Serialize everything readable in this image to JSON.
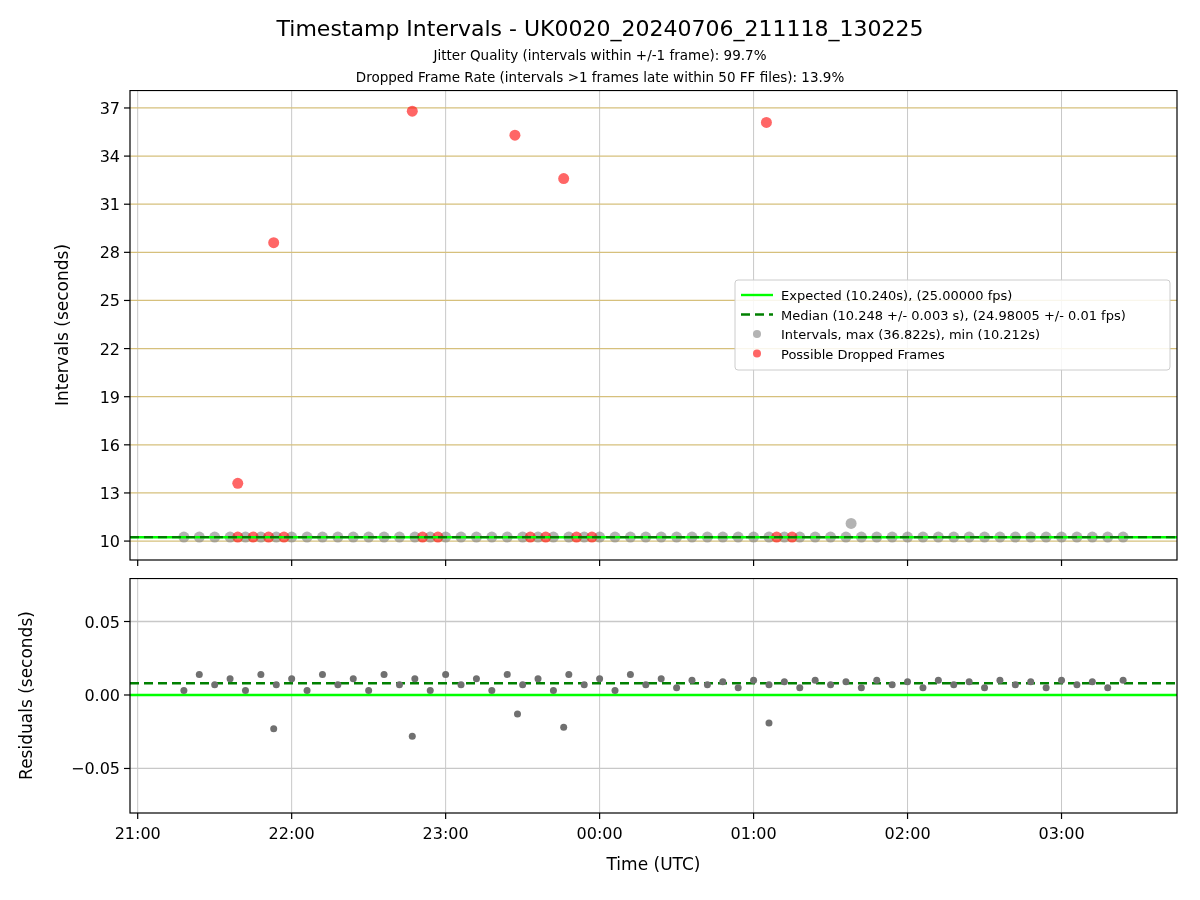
{
  "title": "Timestamp Intervals - UK0020_20240706_211118_130225",
  "subtitles": [
    "Jitter Quality (intervals within +/-1 frame): 99.7%",
    "Dropped Frame Rate (intervals >1 frames late within 50 FF files): 13.9%"
  ],
  "plots": [
    {
      "chart_data": {
        "type": "scatter",
        "grid": true,
        "legend": "center right",
        "ylabel": "Intervals (seconds)",
        "xlim": [
          "2024-07-06T20:57:00",
          "2024-07-07T03:45:00"
        ],
        "ylim": [
          8.82,
          38.12
        ],
        "yticks": [
          10,
          13,
          16,
          19,
          22,
          25,
          28,
          31,
          34,
          37
        ],
        "series": [
          {
            "name": "Expected (10.240s), (25.00000 fps)",
            "type": "line",
            "color": "#00ff00",
            "x": [
              "2024-07-06T20:57:00",
              "2024-07-07T03:45:00"
            ],
            "values": [
              10.24,
              10.24
            ]
          },
          {
            "name": "Median (10.248 +/- 0.003 s), (24.98005 +/- 0.01 fps)",
            "type": "line",
            "line_style": "dashed",
            "color": "#008000",
            "x": [
              "2024-07-06T20:57:00",
              "2024-07-07T03:45:00"
            ],
            "values": [
              10.25,
              10.25
            ]
          },
          {
            "name": "Intervals, max (36.822s), min (10.212s)",
            "type": "scatter",
            "color": "#808080",
            "x": [
              "2024-07-06T21:18:00",
              "2024-07-06T21:24:00",
              "2024-07-06T21:30:00",
              "2024-07-06T21:36:00",
              "2024-07-06T21:42:00",
              "2024-07-06T21:48:00",
              "2024-07-06T21:54:00",
              "2024-07-06T22:00:00",
              "2024-07-06T22:06:00",
              "2024-07-06T22:12:00",
              "2024-07-06T22:18:00",
              "2024-07-06T22:24:00",
              "2024-07-06T22:30:00",
              "2024-07-06T22:36:00",
              "2024-07-06T22:42:00",
              "2024-07-06T22:48:00",
              "2024-07-06T22:54:00",
              "2024-07-06T23:00:00",
              "2024-07-06T23:06:00",
              "2024-07-06T23:12:00",
              "2024-07-06T23:18:00",
              "2024-07-06T23:24:00",
              "2024-07-06T23:30:00",
              "2024-07-06T23:36:00",
              "2024-07-06T23:42:00",
              "2024-07-06T23:48:00",
              "2024-07-06T23:54:00",
              "2024-07-07T00:00:00",
              "2024-07-07T00:06:00",
              "2024-07-07T00:12:00",
              "2024-07-07T00:18:00",
              "2024-07-07T00:24:00",
              "2024-07-07T00:30:00",
              "2024-07-07T00:36:00",
              "2024-07-07T00:42:00",
              "2024-07-07T00:48:00",
              "2024-07-07T00:54:00",
              "2024-07-07T01:00:00",
              "2024-07-07T01:06:00",
              "2024-07-07T01:12:00",
              "2024-07-07T01:18:00",
              "2024-07-07T01:24:00",
              "2024-07-07T01:30:00",
              "2024-07-07T01:36:00",
              "2024-07-07T01:42:00",
              "2024-07-07T01:48:00",
              "2024-07-07T01:54:00",
              "2024-07-07T02:00:00",
              "2024-07-07T02:06:00",
              "2024-07-07T02:12:00",
              "2024-07-07T02:18:00",
              "2024-07-07T02:24:00",
              "2024-07-07T02:30:00",
              "2024-07-07T02:36:00",
              "2024-07-07T02:42:00",
              "2024-07-07T02:48:00",
              "2024-07-07T02:54:00",
              "2024-07-07T03:00:00",
              "2024-07-07T03:06:00",
              "2024-07-07T03:12:00",
              "2024-07-07T03:18:00",
              "2024-07-07T03:24:00",
              "2024-07-07T01:38:00"
            ],
            "values": [
              10.25,
              10.25,
              10.25,
              10.25,
              10.25,
              10.25,
              10.25,
              10.25,
              10.25,
              10.25,
              10.25,
              10.25,
              10.25,
              10.25,
              10.25,
              10.25,
              10.25,
              10.25,
              10.25,
              10.25,
              10.25,
              10.25,
              10.25,
              10.25,
              10.25,
              10.25,
              10.25,
              10.25,
              10.25,
              10.25,
              10.25,
              10.25,
              10.25,
              10.25,
              10.25,
              10.25,
              10.25,
              10.25,
              10.25,
              10.25,
              10.25,
              10.25,
              10.25,
              10.25,
              10.25,
              10.25,
              10.25,
              10.25,
              10.25,
              10.25,
              10.25,
              10.25,
              10.25,
              10.25,
              10.25,
              10.25,
              10.25,
              10.25,
              10.25,
              10.25,
              10.25,
              10.25,
              11.1
            ]
          },
          {
            "name": "Possible Dropped Frames",
            "type": "scatter",
            "color": "#ff0000",
            "x": [
              "2024-07-06T21:39:00",
              "2024-07-06T21:45:00",
              "2024-07-06T21:51:00",
              "2024-07-06T21:57:00",
              "2024-07-06T22:51:00",
              "2024-07-06T22:57:00",
              "2024-07-06T23:33:00",
              "2024-07-06T23:39:00",
              "2024-07-06T23:51:00",
              "2024-07-06T23:57:00",
              "2024-07-07T01:09:00",
              "2024-07-07T01:15:00",
              "2024-07-06T21:39:00",
              "2024-07-06T21:53:00",
              "2024-07-06T22:47:00",
              "2024-07-06T23:27:00",
              "2024-07-06T23:46:00",
              "2024-07-07T01:05:00"
            ],
            "values": [
              10.25,
              10.25,
              10.25,
              10.25,
              10.25,
              10.25,
              10.25,
              10.25,
              10.25,
              10.25,
              10.25,
              10.25,
              13.6,
              28.6,
              36.8,
              35.3,
              32.6,
              36.1
            ]
          }
        ]
      }
    },
    {
      "chart_data": {
        "type": "scatter",
        "grid": true,
        "xlabel": "Time (UTC)",
        "ylabel": "Residuals (seconds)",
        "xlim": [
          "2024-07-06T20:57:00",
          "2024-07-07T03:45:00"
        ],
        "ylim": [
          -0.0803,
          0.0796
        ],
        "xticks": [
          {
            "value": "2024-07-06T21:00:00",
            "label": "21:00"
          },
          {
            "value": "2024-07-06T22:00:00",
            "label": "22:00"
          },
          {
            "value": "2024-07-06T23:00:00",
            "label": "23:00"
          },
          {
            "value": "2024-07-07T00:00:00",
            "label": "00:00"
          },
          {
            "value": "2024-07-07T01:00:00",
            "label": "01:00"
          },
          {
            "value": "2024-07-07T02:00:00",
            "label": "02:00"
          },
          {
            "value": "2024-07-07T03:00:00",
            "label": "03:00"
          }
        ],
        "yticks": [
          {
            "value": -0.05,
            "label": "−0.05"
          },
          {
            "value": 0,
            "label": "0.00"
          },
          {
            "value": 0.05,
            "label": "0.05"
          }
        ],
        "series": [
          {
            "type": "line",
            "color": "#00ff00",
            "x": [
              "2024-07-06T20:57:00",
              "2024-07-07T03:45:00"
            ],
            "values": [
              0,
              0
            ]
          },
          {
            "type": "line",
            "line_style": "dashed",
            "color": "#008000",
            "x": [
              "2024-07-06T20:57:00",
              "2024-07-07T03:45:00"
            ],
            "values": [
              0.008,
              0.008
            ]
          },
          {
            "type": "scatter",
            "color": "#707070",
            "x": [
              "2024-07-06T21:18:00",
              "2024-07-06T21:24:00",
              "2024-07-06T21:30:00",
              "2024-07-06T21:36:00",
              "2024-07-06T21:42:00",
              "2024-07-06T21:48:00",
              "2024-07-06T21:54:00",
              "2024-07-06T22:00:00",
              "2024-07-06T22:06:00",
              "2024-07-06T22:12:00",
              "2024-07-06T22:18:00",
              "2024-07-06T22:24:00",
              "2024-07-06T22:30:00",
              "2024-07-06T22:36:00",
              "2024-07-06T22:42:00",
              "2024-07-06T22:48:00",
              "2024-07-06T22:54:00",
              "2024-07-06T23:00:00",
              "2024-07-06T23:06:00",
              "2024-07-06T23:12:00",
              "2024-07-06T23:18:00",
              "2024-07-06T23:24:00",
              "2024-07-06T23:30:00",
              "2024-07-06T23:36:00",
              "2024-07-06T23:42:00",
              "2024-07-06T23:48:00",
              "2024-07-06T23:54:00",
              "2024-07-07T00:00:00",
              "2024-07-07T00:06:00",
              "2024-07-07T00:12:00",
              "2024-07-07T00:18:00",
              "2024-07-07T00:24:00",
              "2024-07-07T00:30:00",
              "2024-07-07T00:36:00",
              "2024-07-07T00:42:00",
              "2024-07-07T00:48:00",
              "2024-07-07T00:54:00",
              "2024-07-07T01:00:00",
              "2024-07-07T01:06:00",
              "2024-07-07T01:12:00",
              "2024-07-07T01:18:00",
              "2024-07-07T01:24:00",
              "2024-07-07T01:30:00",
              "2024-07-07T01:36:00",
              "2024-07-07T01:42:00",
              "2024-07-07T01:48:00",
              "2024-07-07T01:54:00",
              "2024-07-07T02:00:00",
              "2024-07-07T02:06:00",
              "2024-07-07T02:12:00",
              "2024-07-07T02:18:00",
              "2024-07-07T02:24:00",
              "2024-07-07T02:30:00",
              "2024-07-07T02:36:00",
              "2024-07-07T02:42:00",
              "2024-07-07T02:48:00",
              "2024-07-07T02:54:00",
              "2024-07-07T03:00:00",
              "2024-07-07T03:06:00",
              "2024-07-07T03:12:00",
              "2024-07-07T03:18:00",
              "2024-07-07T03:24:00",
              "2024-07-06T21:53:00",
              "2024-07-06T22:47:00",
              "2024-07-06T23:28:00",
              "2024-07-06T23:46:00",
              "2024-07-07T01:06:00"
            ],
            "values": [
              0.003,
              0.014,
              0.007,
              0.011,
              0.003,
              0.014,
              0.007,
              0.011,
              0.003,
              0.014,
              0.007,
              0.011,
              0.003,
              0.014,
              0.007,
              0.011,
              0.003,
              0.014,
              0.007,
              0.011,
              0.003,
              0.014,
              0.007,
              0.011,
              0.003,
              0.014,
              0.007,
              0.011,
              0.003,
              0.014,
              0.007,
              0.011,
              0.005,
              0.01,
              0.007,
              0.009,
              0.005,
              0.01,
              0.007,
              0.009,
              0.005,
              0.01,
              0.007,
              0.009,
              0.005,
              0.01,
              0.007,
              0.009,
              0.005,
              0.01,
              0.007,
              0.009,
              0.005,
              0.01,
              0.007,
              0.009,
              0.005,
              0.01,
              0.007,
              0.009,
              0.005,
              0.01,
              -0.023,
              -0.028,
              -0.013,
              -0.022,
              -0.019
            ]
          }
        ]
      }
    }
  ]
}
